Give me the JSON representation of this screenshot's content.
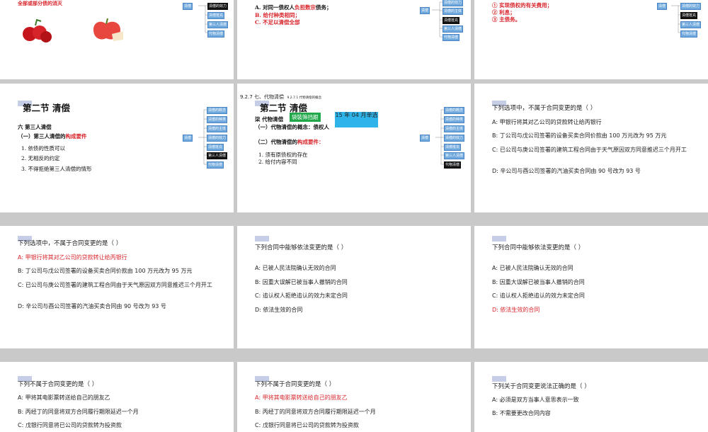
{
  "colors": {
    "accent_red": "#d9242b",
    "mind_box": "#6fa8dc",
    "highlight": "#111111",
    "tab": "#c6cde6",
    "green_badge": "#21a84a",
    "cyan_badge": "#2fb4e9"
  },
  "row1": {
    "s1": {
      "text": "全部或部分债的消灭",
      "fruit_icons": [
        "cherries-icon",
        "apple-icon"
      ]
    },
    "s2": {
      "lines": [
        "A. 对同一债权人负担数宗债务；",
        "B. 给付种类相同；",
        "C. 不足以清偿全部"
      ],
      "line_a_plain1": "A. 对同一债权人",
      "line_a_red": "负担数宗",
      "line_a_plain2": "债务；"
    },
    "s3": {
      "lines": [
        "① 实现债权的有关费用；",
        "② 利息；",
        "③ 主债务。"
      ]
    }
  },
  "mind_rows": {
    "r1_s1": {
      "root": "清偿",
      "items": [
        "清偿的效力",
        "清偿抵充",
        "第三人清偿",
        "代物清偿"
      ]
    },
    "r1_s2": {
      "root": "清偿",
      "items": [
        "清偿的效力",
        "清偿的主体",
        "清偿抵充",
        "第三人清偿",
        "代物清偿"
      ]
    },
    "r1_s3": {
      "root": "清偿",
      "items": [
        "清偿的效力",
        "清偿抵充",
        "第三人清偿",
        "代物清偿"
      ]
    }
  },
  "row2": {
    "s1": {
      "title": "第二节  清偿",
      "heading": "六  第三人清偿",
      "sub1_plain": "（一）第三人清偿的",
      "sub1_red": "构成要件",
      "items": [
        "1. 依债的性质可以",
        "2. 无相反的约定",
        "3.   不得拒绝第三人清偿的情形"
      ],
      "mind": {
        "root": "清偿",
        "items": [
          "清偿的概念",
          "清偿的种类",
          "清偿的主体",
          "清偿的效力",
          "清偿抵充",
          "第三人清偿",
          "代物清偿"
        ]
      }
    },
    "s2": {
      "breadcrumb": "9.2.7  七、代物清偿",
      "breadcrumb_small": "9.2.7.1 代物清偿的概念",
      "title": "第二节  清偿",
      "heading": "柒  代物清偿",
      "sub1": "（一）代物清偿的概念：债权人",
      "green_badge": "袋裝筛挡跟",
      "cyan_badge": "15 年 04 月单选",
      "sub2_plain": "（二）代物清偿的",
      "sub2_red": "构成要件：",
      "items": [
        "1. 须有原债权的存在",
        "2. 给付内容不同"
      ],
      "mind": {
        "root": "清偿",
        "items": [
          "清偿的概念",
          "清偿的种类",
          "清偿的主体",
          "清偿的效力",
          "清偿抵充",
          "第三人清偿",
          "代物清偿"
        ]
      }
    },
    "s3": {
      "question": "下列选项中，不属于合同变更的是（ ）",
      "options": [
        "A: 甲银行将其对乙公司的贷款转让给丙银行",
        "B: 丁公司与戊公司签署的设备买卖合同价款由 100 万元改为 95 万元",
        "C: 已公司与庚公司签署的建筑工程合同由于天气原因双方同意推迟三个月开工",
        "D: 辛公司与酉公司签署的汽油买卖合同由 90 号改为 93 号"
      ]
    }
  },
  "row3": {
    "s1": {
      "question": "下列选项中，不属于合同变更的是（ ）",
      "options": [
        "A: 甲银行将其对乙公司的贷款转让给丙银行",
        "B: 丁公司与戊公司签署的设备买卖合同价款由 100 万元改为 95 万元",
        "C: 已公司与庚公司签署的建筑工程合同由于天气原因双方同意推迟三个月开工",
        "D: 辛公司与酉公司签署的汽油买卖合同由 90 号改为 93 号"
      ]
    },
    "s2": {
      "question": "下列合同中能够依法变更的是（ ）",
      "options": [
        "A: 已被人民法院确认无效的合同",
        "B: 因重大误解已被当事人撤销的合同",
        "C: 追认权人拒绝追认的效力未定合同",
        "D: 依法生效的合同"
      ]
    },
    "s3": {
      "question": "下列合同中能够依法变更的是（ ）",
      "options": [
        "A: 已被人民法院确认无效的合同",
        "B: 因重大误解已被当事人撤销的合同",
        "C: 追认权人拒绝追认的效力未定合同",
        "D: 依法生效的合同"
      ]
    }
  },
  "row4": {
    "s1": {
      "question": "下列不属于合同变更的是（ ）",
      "options": [
        "A: 甲将其电影票转送给自己的朋友乙",
        "B: 丙经丁的同意将双方合同履行期限延迟一个月",
        "C: 戊银行同意将已公司的贷款转为投资款"
      ]
    },
    "s2": {
      "question": "下列不属于合同变更的是（ ）",
      "options": [
        "A: 甲将其电影票转送给自己的朋友乙",
        "B: 丙经丁的同意将双方合同履行期限延迟一个月",
        "C: 戊银行同意将已公司的贷款转为投资款"
      ]
    },
    "s3": {
      "question": "下列关于合同变更说法正确的是（ ）",
      "options": [
        "A: 必须是双方当事人意思表示一致",
        "B: 不需要更改合同内容"
      ]
    }
  }
}
